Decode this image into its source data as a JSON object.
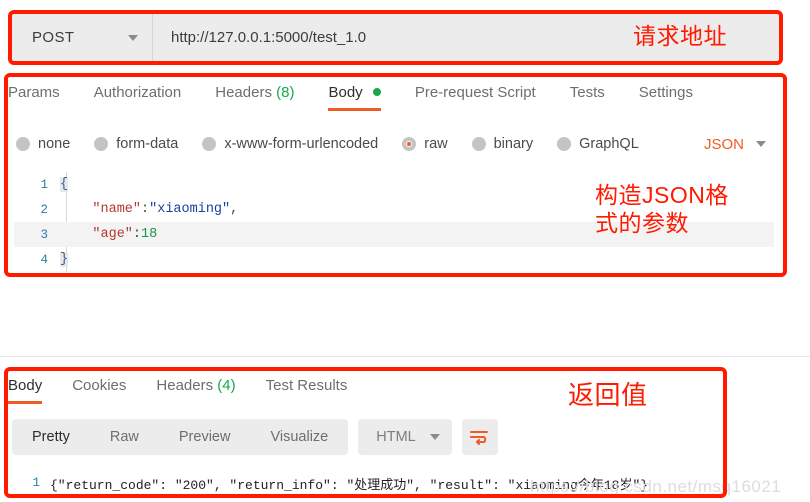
{
  "url_bar": {
    "method": "POST",
    "method_caret_icon": "chevron-down-icon",
    "url": "http://127.0.0.1:5000/test_1.0"
  },
  "annotations": {
    "url": "请求地址",
    "json_body": "构造JSON格\n式的参数",
    "response": "返回值"
  },
  "request_tabs": [
    {
      "label": "Params",
      "active": false
    },
    {
      "label": "Authorization",
      "active": false
    },
    {
      "label": "Headers",
      "count": "(8)",
      "active": false
    },
    {
      "label": "Body",
      "active": true,
      "dot": true
    },
    {
      "label": "Pre-request Script",
      "active": false
    },
    {
      "label": "Tests",
      "active": false
    },
    {
      "label": "Settings",
      "active": false
    }
  ],
  "body_types": [
    {
      "label": "none",
      "selected": false
    },
    {
      "label": "form-data",
      "selected": false
    },
    {
      "label": "x-www-form-urlencoded",
      "selected": false
    },
    {
      "label": "raw",
      "selected": true
    },
    {
      "label": "binary",
      "selected": false
    },
    {
      "label": "GraphQL",
      "selected": false
    }
  ],
  "format_select": {
    "label": "JSON",
    "caret_icon": "chevron-down-icon"
  },
  "editor": {
    "lines": [
      {
        "number": "1",
        "open_brace": "{"
      },
      {
        "number": "2",
        "key": "\"name\"",
        "colon": ":",
        "value": "\"xiaoming\"",
        "comma": ","
      },
      {
        "number": "3",
        "key": "\"age\"",
        "colon": ":",
        "num": "18",
        "highlight": true
      },
      {
        "number": "4",
        "close_brace": "}"
      }
    ]
  },
  "response_tabs": [
    {
      "label": "Body",
      "active": true
    },
    {
      "label": "Cookies",
      "active": false
    },
    {
      "label": "Headers",
      "count": "(4)",
      "active": false
    },
    {
      "label": "Test Results",
      "active": false
    }
  ],
  "response_toolbar": {
    "views": [
      {
        "label": "Pretty",
        "active": true
      },
      {
        "label": "Raw",
        "active": false
      },
      {
        "label": "Preview",
        "active": false
      },
      {
        "label": "Visualize",
        "active": false
      }
    ],
    "format": {
      "label": "HTML",
      "caret_icon": "chevron-down-icon"
    },
    "wrap_button_icon": "word-wrap-icon"
  },
  "response_body": {
    "line_number": "1",
    "text": "{\"return_code\": \"200\", \"return_info\": \"处理成功\", \"result\": \"xiaoming今年18岁\"}"
  },
  "watermark": "https://blog.csdn.net/msq16021",
  "colors": {
    "accent_orange": "#ef5b25",
    "annotation_red": "#ff1a00",
    "success_green": "#17a94b",
    "toolbar_grey": "#ececec"
  }
}
